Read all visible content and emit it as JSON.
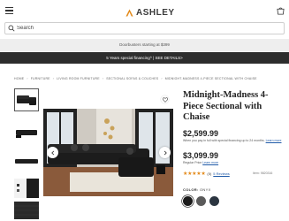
{
  "header": {
    "brand": "ASHLEY"
  },
  "search": {
    "placeholder": "Search"
  },
  "promo_banner": "Doorbusters starting at $399",
  "financing_banner": "5 Years special financing^ | SEE DETAILS>",
  "breadcrumbs": [
    "HOME",
    "FURNITURE",
    "LIVING ROOM FURNITURE",
    "SECTIONAL SOFAS & COUCHES",
    "MIDNIGHT-MADNESS 4-PIECE SECTIONAL WITH CHAISE"
  ],
  "product": {
    "title": "Midnight-Madness 4-Piece Sectional with Chaise",
    "sale_price": "$2,599.99",
    "financing_text": "When you pay in full with special financing up to 24 months.",
    "financing_link": "Learn more",
    "regular_price": "$3,099.99",
    "regular_text": "Regular Price",
    "regular_link": "Learn more",
    "rating": 4.7,
    "stars": "★★★★★",
    "rating_count": "(5)",
    "reviews_link": "5 Reviews",
    "item_number": "Item: 9820316"
  },
  "color": {
    "label": "COLOR:",
    "selected": "ONYX",
    "swatches": [
      "#1a1a1a",
      "#5a5a5a",
      "#2b3540"
    ]
  },
  "colors": {
    "accent": "#e38a1b",
    "banner_dark": "#2d2d2d",
    "link": "#1f5aa8"
  }
}
